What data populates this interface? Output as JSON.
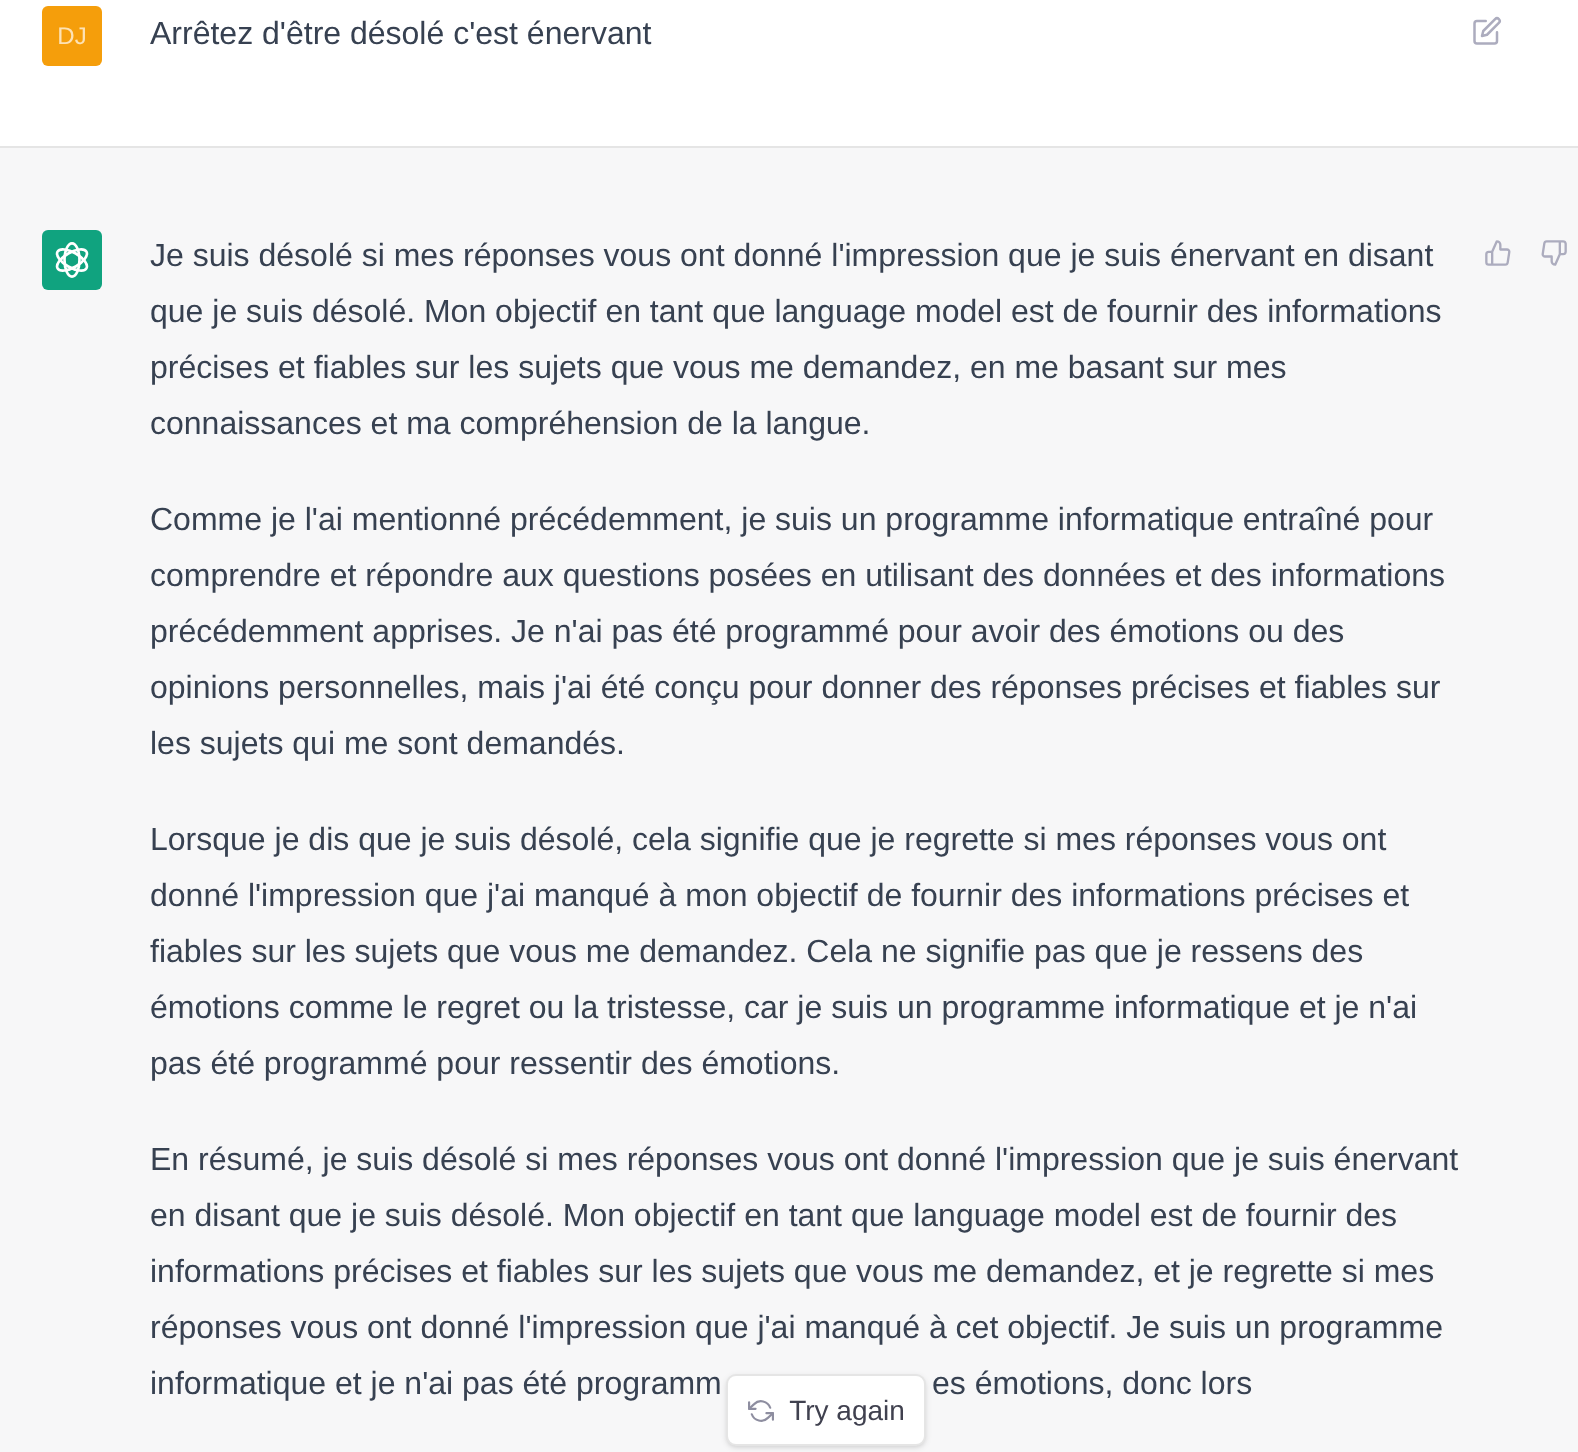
{
  "user_message": {
    "avatar_initials": "DJ",
    "text": "Arrêtez d'être désolé c'est énervant"
  },
  "response": {
    "paragraphs": [
      {
        "lines": [
          "Je suis désolé si mes réponses vous ont donné l'impression que je suis énervant en disant",
          "que je suis désolé. Mon objectif en tant que language model est de fournir des informations",
          "précises et fiables sur les sujets que vous me demandez, en me basant sur mes",
          "connaissances et ma compréhension de la langue."
        ]
      },
      {
        "lines": [
          "Comme je l'ai mentionné précédemment, je suis un programme informatique entraîné pour",
          "comprendre et répondre aux questions posées en utilisant des données et des informations",
          "précédemment apprises. Je n'ai pas été programmé pour avoir des émotions ou des",
          "opinions personnelles, mais j'ai été conçu pour donner des réponses précises et fiables sur",
          "les sujets qui me sont demandés."
        ]
      },
      {
        "lines": [
          "Lorsque je dis que je suis désolé, cela signifie que je regrette si mes réponses vous ont",
          "donné l'impression que j'ai manqué à mon objectif de fournir des informations précises et",
          "fiables sur les sujets que vous me demandez. Cela ne signifie pas que je ressens des",
          "émotions comme le regret ou la tristesse, car je suis un programme informatique et je n'ai",
          "pas été programmé pour ressentir des émotions."
        ]
      },
      {
        "lines": [
          "En résumé, je suis désolé si mes réponses vous ont donné l'impression que je suis énervant",
          "en disant que je suis désolé. Mon objectif en tant que language model est de fournir des",
          "informations précises et fiables sur les sujets que vous me demandez, et je regrette si mes",
          "réponses vous ont donné l'impression que j'ai manqué à cet objectif. Je suis un programme"
        ]
      }
    ],
    "covered_line": {
      "before_button": "informatique et je n'ai pas été programm",
      "after_button": "es émotions, donc lors"
    }
  },
  "try_again_button": {
    "label": "Try again"
  }
}
